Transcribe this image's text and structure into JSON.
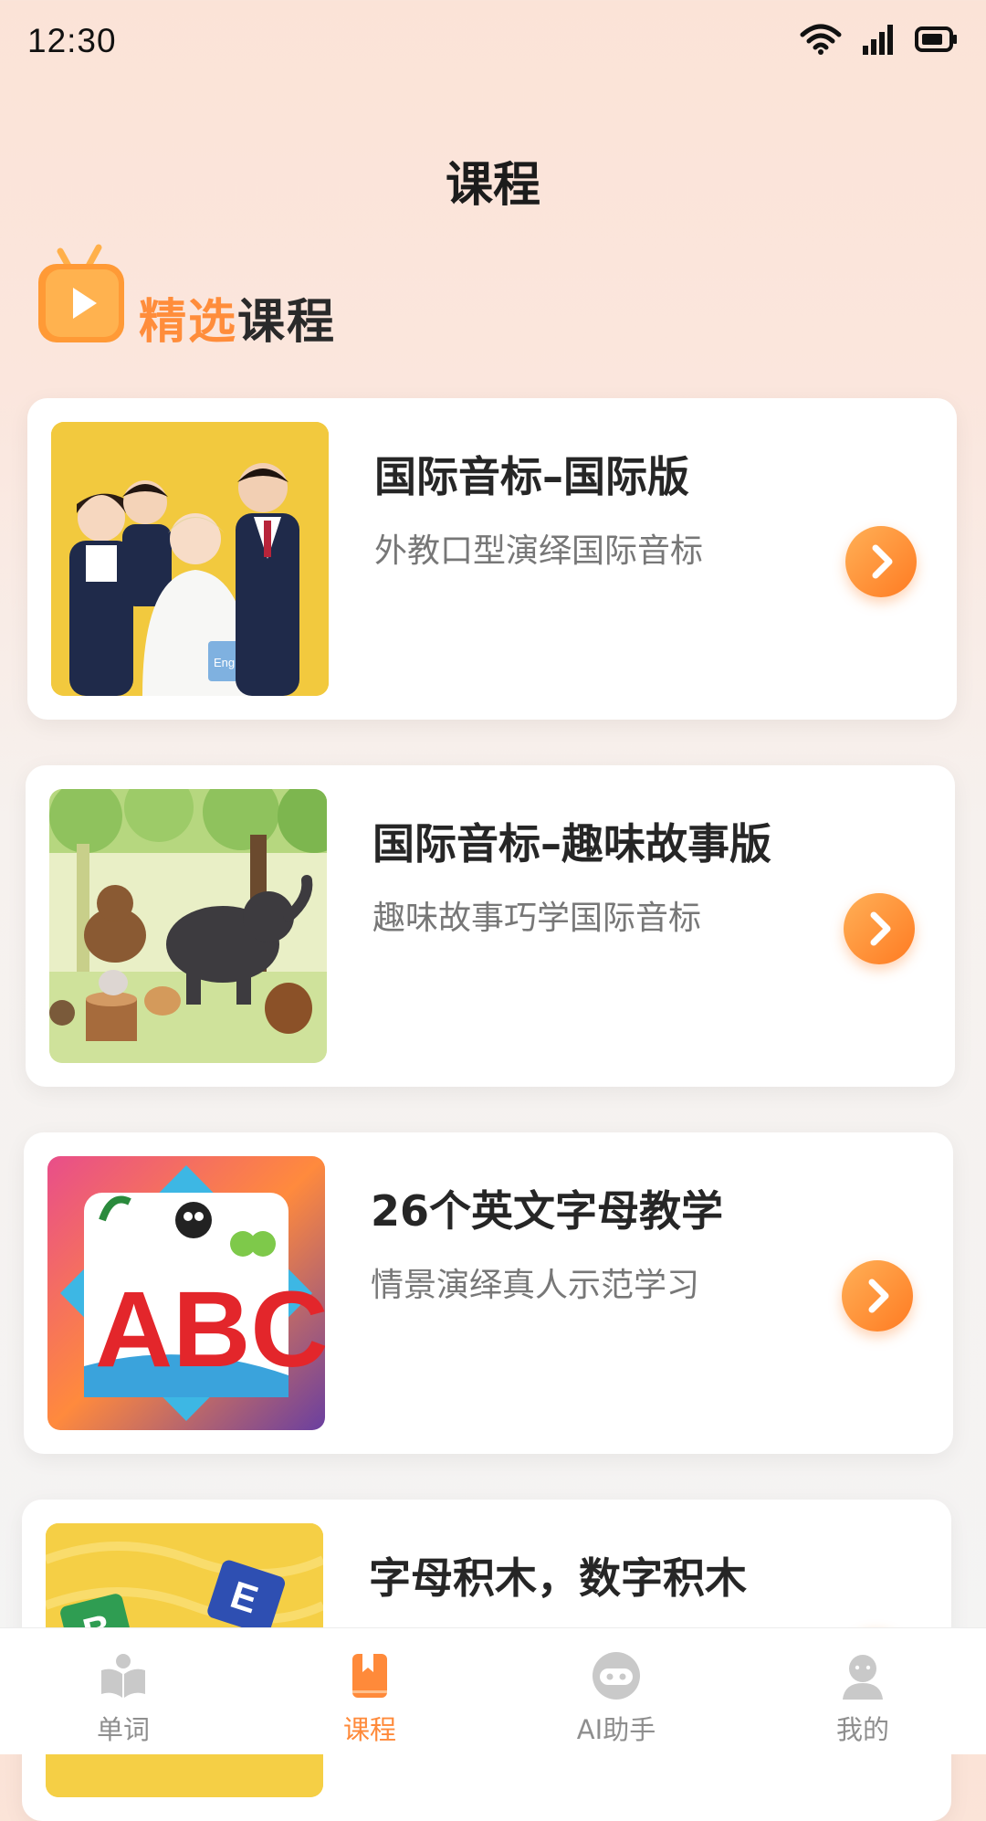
{
  "status": {
    "time": "12:30"
  },
  "header": {
    "title": "课程"
  },
  "section": {
    "title_highlight": "精选",
    "title_rest": "课程"
  },
  "courses": [
    {
      "title": "国际音标–国际版",
      "subtitle": "外教口型演绎国际音标"
    },
    {
      "title": "国际音标–趣味故事版",
      "subtitle": "趣味故事巧学国际音标"
    },
    {
      "title": "26个英文字母教学",
      "subtitle": "情景演绎真人示范学习"
    },
    {
      "title": "字母积木，数字积木",
      "subtitle": ""
    }
  ],
  "thumb_text": {
    "book": "English",
    "letters": "ABC",
    "block1": "B",
    "block2": "E"
  },
  "tabs": [
    {
      "label": "单词",
      "icon": "book-open-icon"
    },
    {
      "label": "课程",
      "icon": "bookmark-book-icon",
      "active": true
    },
    {
      "label": "AI助手",
      "icon": "robot-chat-icon"
    },
    {
      "label": "我的",
      "icon": "user-icon"
    }
  ],
  "colors": {
    "accent": "#ff8a3a",
    "inactive": "#8e8e8e"
  }
}
